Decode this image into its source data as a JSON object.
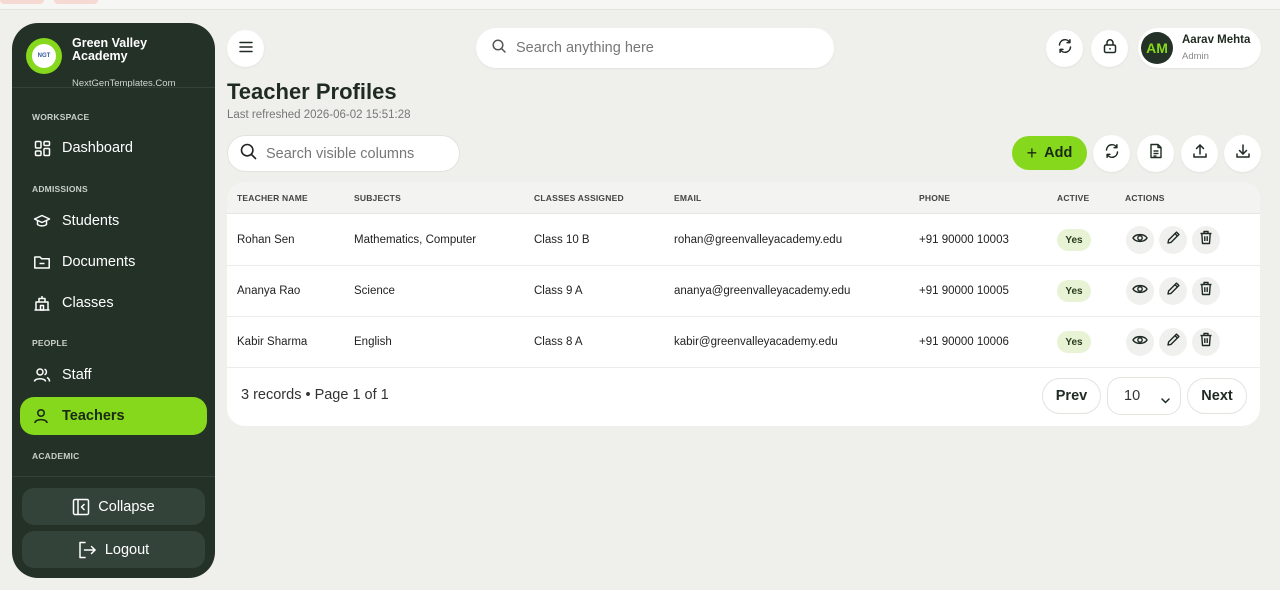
{
  "brand": {
    "logo_text": "NGT",
    "name": "Green Valley Academy",
    "subtitle": "NextGenTemplates.Com"
  },
  "sidebar": {
    "sections": {
      "workspace": "WORKSPACE",
      "admissions": "ADMISSIONS",
      "people": "PEOPLE",
      "academic": "ACADEMIC"
    },
    "items": [
      {
        "label": "Dashboard",
        "icon": "grid-icon"
      },
      {
        "label": "Students",
        "icon": "graduation-cap-icon"
      },
      {
        "label": "Documents",
        "icon": "folder-icon"
      },
      {
        "label": "Classes",
        "icon": "school-icon"
      },
      {
        "label": "Staff",
        "icon": "users-icon"
      },
      {
        "label": "Teachers",
        "icon": "user-icon",
        "active": true
      }
    ],
    "collapse_label": "Collapse",
    "logout_label": "Logout"
  },
  "header": {
    "search_placeholder": "Search anything here",
    "user": {
      "initials": "AM",
      "name": "Aarav Mehta",
      "role": "Admin"
    }
  },
  "page": {
    "title": "Teacher Profiles",
    "subtitle": "Last refreshed 2026-06-02 15:51:28",
    "column_search_placeholder": "Search visible columns",
    "add_label": "Add"
  },
  "table": {
    "columns": [
      "TEACHER NAME",
      "SUBJECTS",
      "CLASSES ASSIGNED",
      "EMAIL",
      "PHONE",
      "ACTIVE",
      "ACTIONS"
    ],
    "rows": [
      {
        "name": "Rohan Sen",
        "subjects": "Mathematics, Computer",
        "classes": "Class 10 B",
        "email": "rohan@greenvalleyacademy.edu",
        "phone": "+91 90000 10003",
        "active": "Yes"
      },
      {
        "name": "Ananya Rao",
        "subjects": "Science",
        "classes": "Class 9 A",
        "email": "ananya@greenvalleyacademy.edu",
        "phone": "+91 90000 10005",
        "active": "Yes"
      },
      {
        "name": "Kabir Sharma",
        "subjects": "English",
        "classes": "Class 8 A",
        "email": "kabir@greenvalleyacademy.edu",
        "phone": "+91 90000 10006",
        "active": "Yes"
      }
    ]
  },
  "pagination": {
    "records": "3 records • Page 1 of 1",
    "prev": "Prev",
    "page_size": "10",
    "next": "Next"
  },
  "colors": {
    "accent": "#86d81c",
    "sidebar_bg": "#233127",
    "page_bg": "#efefeb"
  }
}
